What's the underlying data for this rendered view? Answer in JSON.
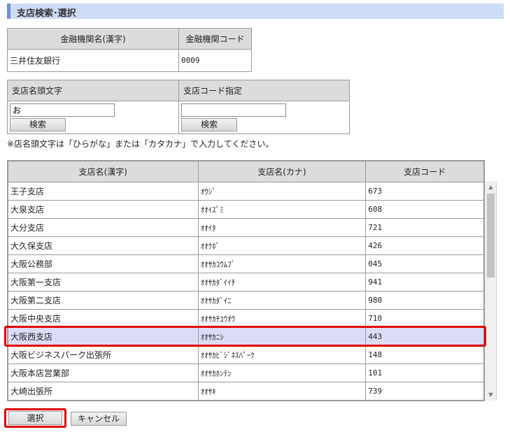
{
  "page": {
    "title": "支店検索･選択"
  },
  "bank": {
    "headers": [
      "金融機関名(漢字)",
      "金融機関コード"
    ],
    "name": "三井住友銀行",
    "code": "0009"
  },
  "search": {
    "initial_header": "支店名頭文字",
    "code_header": "支店コード指定",
    "initial_value": "お",
    "code_value": "",
    "search_label": "検索",
    "note": "※店名頭文字は「ひらがな」または「カタカナ」で入力してください。"
  },
  "branch_list": {
    "headers": [
      "支店名(漢字)",
      "支店名(カナ)",
      "支店コード"
    ],
    "selected_index": 8,
    "rows": [
      {
        "name": "王子支店",
        "kana": "ｵｳｼﾞ",
        "code": "673"
      },
      {
        "name": "大泉支店",
        "kana": "ｵｵｲｽﾞﾐ",
        "code": "608"
      },
      {
        "name": "大分支店",
        "kana": "ｵｵｲﾀ",
        "code": "721"
      },
      {
        "name": "大久保支店",
        "kana": "ｵｵｸﾎﾞ",
        "code": "426"
      },
      {
        "name": "大阪公務部",
        "kana": "ｵｵｻｶｺｳﾑﾌﾞ",
        "code": "045"
      },
      {
        "name": "大阪第一支店",
        "kana": "ｵｵｻｶﾀﾞｲｲﾁ",
        "code": "941"
      },
      {
        "name": "大阪第二支店",
        "kana": "ｵｵｻｶﾀﾞｲﾆ",
        "code": "980"
      },
      {
        "name": "大阪中央支店",
        "kana": "ｵｵｻｶﾁﾕｳｵｳ",
        "code": "710"
      },
      {
        "name": "大阪西支店",
        "kana": "ｵｵｻｶﾆｼ",
        "code": "443"
      },
      {
        "name": "大阪ビジネスパーク出張所",
        "kana": "ｵｵｻｶﾋﾞｼﾞﾈｽﾊﾟｰｸ",
        "code": "148"
      },
      {
        "name": "大阪本店営業部",
        "kana": "ｵｵｻｶﾎﾝﾃﾝ",
        "code": "101"
      },
      {
        "name": "大崎出張所",
        "kana": "ｵｵｻｷ",
        "code": "739"
      }
    ]
  },
  "footer": {
    "select_label": "選択",
    "cancel_label": "キャンセル"
  },
  "colors": {
    "highlight": "#e00000",
    "selected_row": "#dcdcf8",
    "title_bg": "#cfdcf8"
  },
  "icons": {
    "scroll_up": "▲",
    "scroll_down": "▼"
  }
}
